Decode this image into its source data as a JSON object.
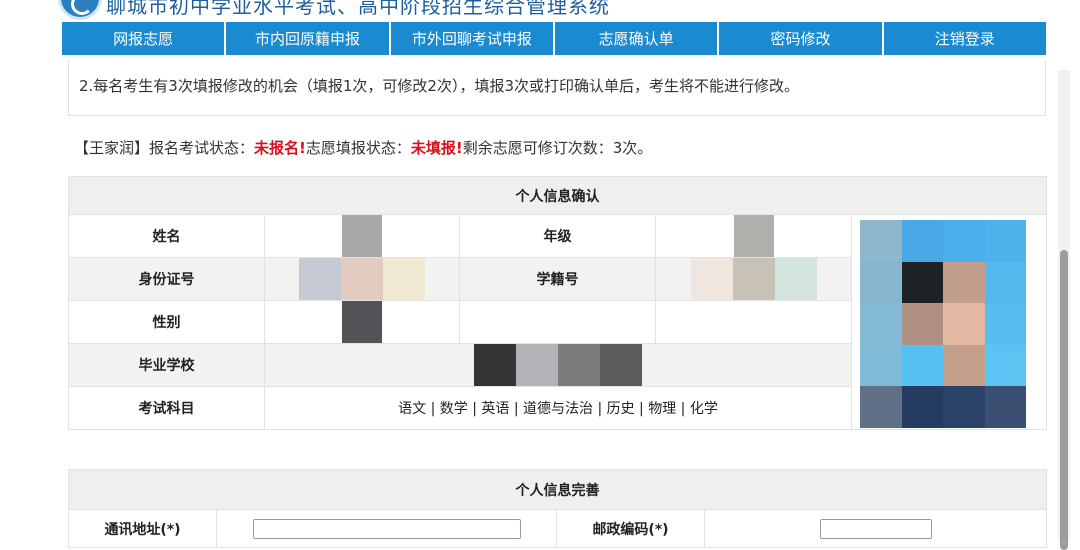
{
  "header": {
    "site_title": "聊城市初中学业水平考试、高中阶段招生综合管理系统"
  },
  "nav": {
    "items": [
      "网报志愿",
      "市内回原籍申报",
      "市外回聊考试申报",
      "志愿确认单",
      "密码修改",
      "注销登录"
    ]
  },
  "notice": {
    "text": "2.每名考生有3次填报修改的机会（填报1次，可修改2次），填报3次或打印确认单后，考生将不能进行修改。"
  },
  "status": {
    "name_tag": "【王家润】",
    "exam_label": "报名考试状态：",
    "exam_value": "未报名!",
    "wish_label": "志愿填报状态：",
    "wish_value": "未填报!",
    "remaining_label": "剩余志愿可修订次数：",
    "remaining_value": "3次。"
  },
  "personal_info": {
    "title": "个人信息确认",
    "name_label": "姓名",
    "grade_label": "年级",
    "id_label": "身份证号",
    "student_no_label": "学籍号",
    "gender_label": "性别",
    "school_label": "毕业学校",
    "subjects_label": "考试科目",
    "subjects_value": "语文 | 数学 | 英语 | 道德与法治 | 历史 | 物理 | 化学"
  },
  "personal_complete": {
    "title": "个人信息完善",
    "address_label": "通讯地址(*)",
    "address_value": "",
    "postcode_label": "邮政编码(*)",
    "postcode_value": ""
  },
  "colors": {
    "nav_bg": "#1b8bd1",
    "status_red": "#d9101b",
    "section_header_bg": "#efefef"
  }
}
